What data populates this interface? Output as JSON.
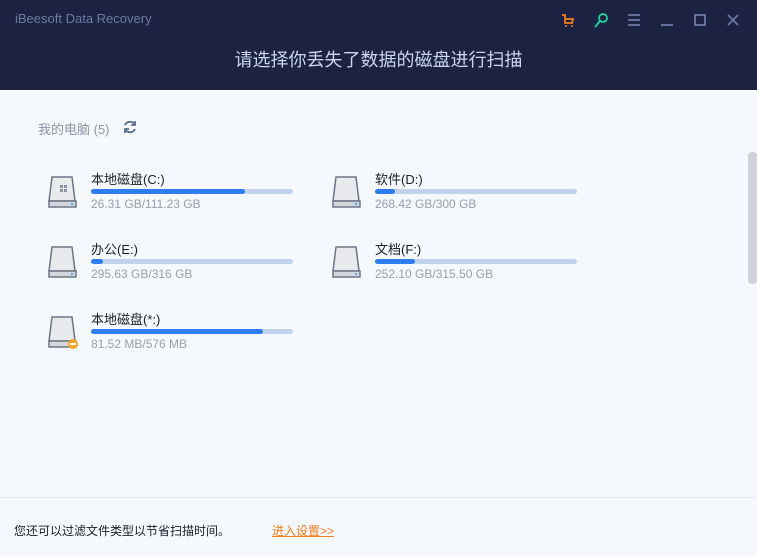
{
  "app": {
    "title": "iBeesoft Data Recovery",
    "headline": "请选择你丢失了数据的磁盘进行扫描"
  },
  "header_icons": [
    "cart-icon",
    "key-icon",
    "menu-icon",
    "minimize-icon",
    "maximize-icon",
    "close-icon"
  ],
  "colors": {
    "accent": "#2e7ef2",
    "header": "#1c2241",
    "cart": "#f07d1e",
    "key": "#1ed6a0"
  },
  "section": {
    "title": "我的电脑 (5)"
  },
  "drives": [
    {
      "name": "本地磁盘(C:)",
      "size": "26.31 GB/111.23 GB",
      "fill_percent": 76,
      "type": "system"
    },
    {
      "name": "软件(D:)",
      "size": "268.42 GB/300 GB",
      "fill_percent": 10,
      "type": "normal"
    },
    {
      "name": "办公(E:)",
      "size": "295.63 GB/316 GB",
      "fill_percent": 6,
      "type": "normal"
    },
    {
      "name": "文档(F:)",
      "size": "252.10 GB/315.50 GB",
      "fill_percent": 20,
      "type": "normal"
    },
    {
      "name": "本地磁盘(*:)",
      "size": "81.52 MB/576 MB",
      "fill_percent": 85,
      "type": "warning"
    }
  ],
  "footer": {
    "tip": "您还可以过滤文件类型以节省扫描时间。",
    "link": "进入设置>>"
  }
}
